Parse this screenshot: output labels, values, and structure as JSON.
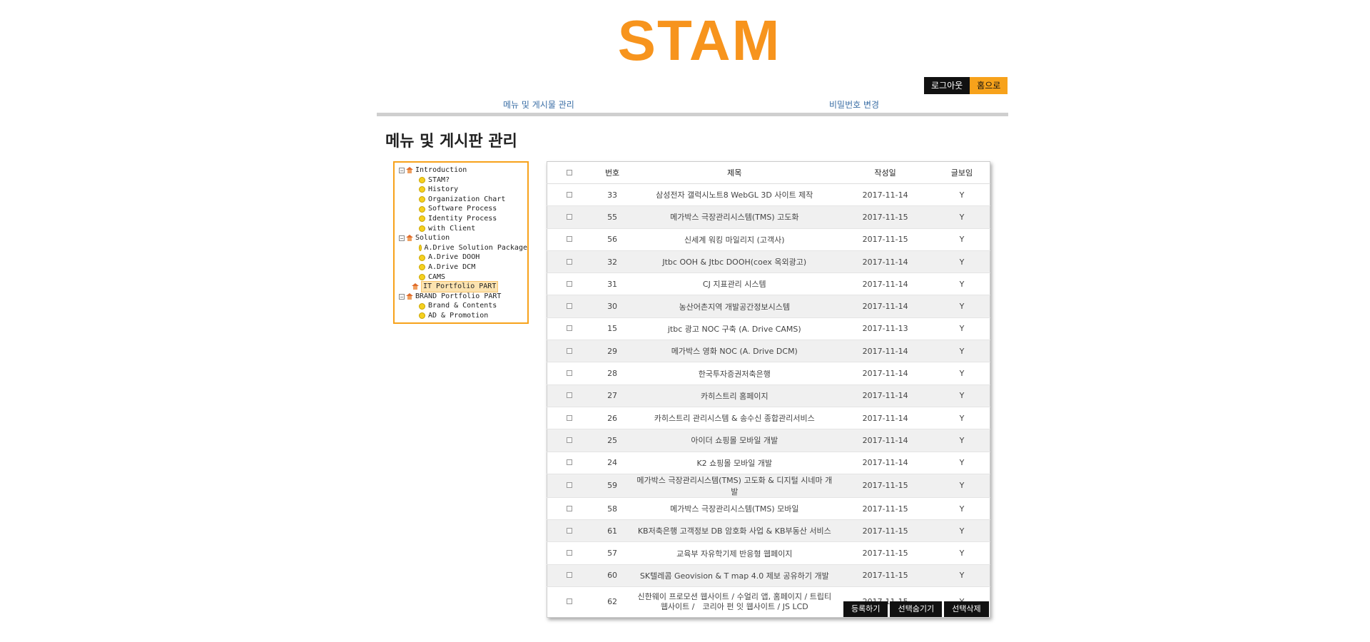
{
  "logo": "STAM",
  "auth": {
    "logout": "로그아웃",
    "home": "홈으로"
  },
  "nav": {
    "menu_manage": "메뉴 및 게시물 관리",
    "password_change": "비밀번호 변경"
  },
  "page_title": "메뉴 및 게시판 관리",
  "tree": [
    {
      "type": "folder",
      "label": "Introduction"
    },
    {
      "type": "leaf",
      "label": "STAM?"
    },
    {
      "type": "leaf",
      "label": "History"
    },
    {
      "type": "leaf",
      "label": "Organization Chart"
    },
    {
      "type": "leaf",
      "label": "Software Process"
    },
    {
      "type": "leaf",
      "label": "Identity Process"
    },
    {
      "type": "leaf",
      "label": "with Client"
    },
    {
      "type": "folder",
      "label": "Solution"
    },
    {
      "type": "leaf",
      "label": "A.Drive Solution Package"
    },
    {
      "type": "leaf",
      "label": "A.Drive DOOH"
    },
    {
      "type": "leaf",
      "label": "A.Drive DCM"
    },
    {
      "type": "leaf",
      "label": "CAMS"
    },
    {
      "type": "selected",
      "label": "IT Portfolio PART"
    },
    {
      "type": "folder",
      "label": "BRAND Portfolio PART"
    },
    {
      "type": "leaf",
      "label": "Brand & Contents"
    },
    {
      "type": "leaf",
      "label": "AD & Promotion"
    }
  ],
  "table": {
    "headers": {
      "no": "번호",
      "title": "제목",
      "date": "작성일",
      "visible": "글보임"
    },
    "rows": [
      {
        "no": "33",
        "title": "삼성전자 갤럭시노트8 WebGL 3D 사이트 제작",
        "date": "2017-11-14",
        "visible": "Y"
      },
      {
        "no": "55",
        "title": "메가박스 극장관리시스템(TMS) 고도화",
        "date": "2017-11-15",
        "visible": "Y"
      },
      {
        "no": "56",
        "title": "신세계 워킹 마일리지 (고객사)",
        "date": "2017-11-15",
        "visible": "Y"
      },
      {
        "no": "32",
        "title": "Jtbc OOH & Jtbc DOOH(coex 옥외광고)",
        "date": "2017-11-14",
        "visible": "Y"
      },
      {
        "no": "31",
        "title": "CJ 지표관리 시스템",
        "date": "2017-11-14",
        "visible": "Y"
      },
      {
        "no": "30",
        "title": "농산어촌지역 개발공간정보시스템",
        "date": "2017-11-14",
        "visible": "Y"
      },
      {
        "no": "15",
        "title": "jtbc 광고 NOC 구축 (A. Drive CAMS)",
        "date": "2017-11-13",
        "visible": "Y"
      },
      {
        "no": "29",
        "title": "메가박스 영화 NOC (A. Drive DCM)",
        "date": "2017-11-14",
        "visible": "Y"
      },
      {
        "no": "28",
        "title": "한국투자증권저축은행",
        "date": "2017-11-14",
        "visible": "Y"
      },
      {
        "no": "27",
        "title": "카히스트리 홈페이지",
        "date": "2017-11-14",
        "visible": "Y"
      },
      {
        "no": "26",
        "title": "카히스트리 관리시스템 & 송수신 종합관리서비스",
        "date": "2017-11-14",
        "visible": "Y"
      },
      {
        "no": "25",
        "title": "아이더 쇼핑몰 모바일 개발",
        "date": "2017-11-14",
        "visible": "Y"
      },
      {
        "no": "24",
        "title": "K2 쇼핑몰 모바일 개발",
        "date": "2017-11-14",
        "visible": "Y"
      },
      {
        "no": "59",
        "title": "메가박스 극장관리시스템(TMS) 고도화 & 디지털 시네마 개발",
        "date": "2017-11-15",
        "visible": "Y"
      },
      {
        "no": "58",
        "title": "메가박스 극장관리시스템(TMS) 모바일",
        "date": "2017-11-15",
        "visible": "Y"
      },
      {
        "no": "61",
        "title": "KB저축은행 고객정보 DB 암호화 사업 & KB부동산 서비스",
        "date": "2017-11-15",
        "visible": "Y"
      },
      {
        "no": "57",
        "title": "교육부 자유학기제 반응형 웹페이지",
        "date": "2017-11-15",
        "visible": "Y"
      },
      {
        "no": "60",
        "title": "SK텔레콤 Geovision & T map 4.0 제보 공유하기 개발",
        "date": "2017-11-15",
        "visible": "Y"
      },
      {
        "no": "62",
        "title": "신한웨이 프로모션 웹사이트 / 수얼리 앱, 홈페이지 / 트립티 웹사이트 /　코리아 펀 잇 웹사이트 / JS LCD",
        "date": "2017-11-15",
        "visible": "Y"
      }
    ]
  },
  "actions": {
    "register": "등록하기",
    "hide_selected": "선택숨기기",
    "delete_selected": "선택삭제"
  }
}
